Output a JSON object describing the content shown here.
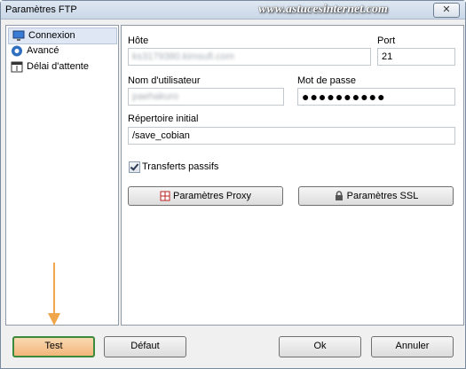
{
  "window": {
    "title": "Paramètres FTP",
    "watermark": "www.astucesinternet.com",
    "close_label": "✕"
  },
  "sidebar": {
    "items": [
      {
        "label": "Connexion",
        "icon": "monitor-icon",
        "selected": true
      },
      {
        "label": "Avancé",
        "icon": "gear-icon",
        "selected": false
      },
      {
        "label": "Délai d'attente",
        "icon": "clock-window-icon",
        "selected": false
      }
    ]
  },
  "form": {
    "host_label": "Hôte",
    "host_value": "ks3179380.kimsufi.com",
    "port_label": "Port",
    "port_value": "21",
    "user_label": "Nom d'utilisateur",
    "user_value": "paehakuro",
    "password_label": "Mot de passe",
    "password_value": "●●●●●●●●●●",
    "dir_label": "Répertoire initial",
    "dir_value": "/save_cobian",
    "passive_label": "Transferts passifs",
    "passive_checked": true,
    "proxy_button": "Paramètres Proxy",
    "ssl_button": "Paramètres SSL"
  },
  "footer": {
    "test_button": "Test",
    "default_button": "Défaut",
    "ok_button": "Ok",
    "cancel_button": "Annuler"
  },
  "colors": {
    "arrow": "#f0a64a",
    "test_button_fill": "#f3b67b",
    "test_button_border": "#3c8a3c",
    "selected_item": "#dfe7f5"
  }
}
